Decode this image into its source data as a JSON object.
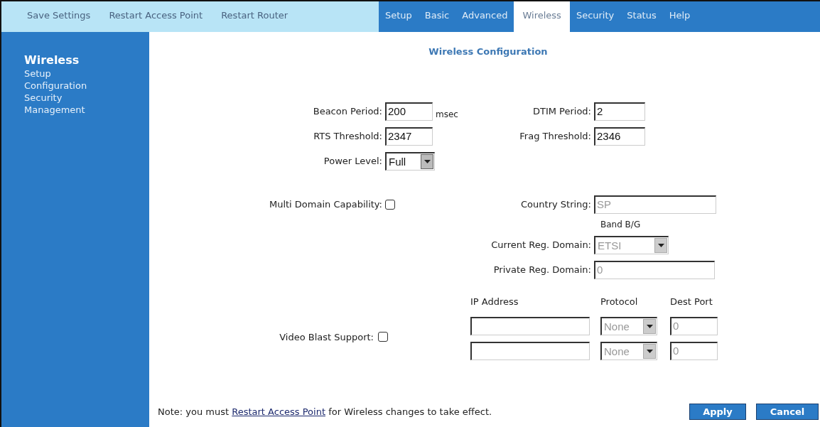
{
  "actions": [
    "Save Settings",
    "Restart Access Point",
    "Restart Router"
  ],
  "tabs": [
    {
      "label": "Setup",
      "selected": false
    },
    {
      "label": "Basic",
      "selected": false
    },
    {
      "label": "Advanced",
      "selected": false
    },
    {
      "label": "Wireless",
      "selected": true
    },
    {
      "label": "Security",
      "selected": false
    },
    {
      "label": "Status",
      "selected": false
    },
    {
      "label": "Help",
      "selected": false
    }
  ],
  "sidebar": {
    "heading": "Wireless",
    "items": [
      "Setup",
      "Configuration",
      "Security",
      "Management"
    ]
  },
  "title": "Wireless Configuration",
  "beacon_period": {
    "label": "Beacon Period:",
    "value": "200",
    "unit": "msec"
  },
  "dtim_period": {
    "label": "DTIM Period:",
    "value": "2"
  },
  "rts_threshold": {
    "label": "RTS Threshold:",
    "value": "2347"
  },
  "frag_threshold": {
    "label": "Frag Threshold:",
    "value": "2346"
  },
  "power_level": {
    "label": "Power Level:",
    "value": "Full"
  },
  "multi_domain": {
    "label": "Multi Domain Capability:",
    "checked": false
  },
  "country_string": {
    "label": "Country String:",
    "value": "SP",
    "disabled": true
  },
  "band": "Band B/G",
  "current_reg_domain": {
    "label": "Current Reg. Domain:",
    "value": "ETSI",
    "disabled": true
  },
  "private_reg_domain": {
    "label": "Private Reg. Domain:",
    "value": "0",
    "disabled": true
  },
  "video_blast": {
    "label": "Video Blast Support:",
    "checked": false,
    "columns": [
      "IP Address",
      "Protocol",
      "Dest Port"
    ],
    "rows": [
      {
        "protocol": "None",
        "port": "0",
        "disabled": true
      },
      {
        "protocol": "None",
        "port": "0",
        "disabled": true
      }
    ]
  },
  "note": {
    "before": "Note: you must ",
    "link": "Restart Access Point",
    "after": " for Wireless changes to take effect."
  },
  "buttons": [
    "Apply",
    "Cancel"
  ]
}
